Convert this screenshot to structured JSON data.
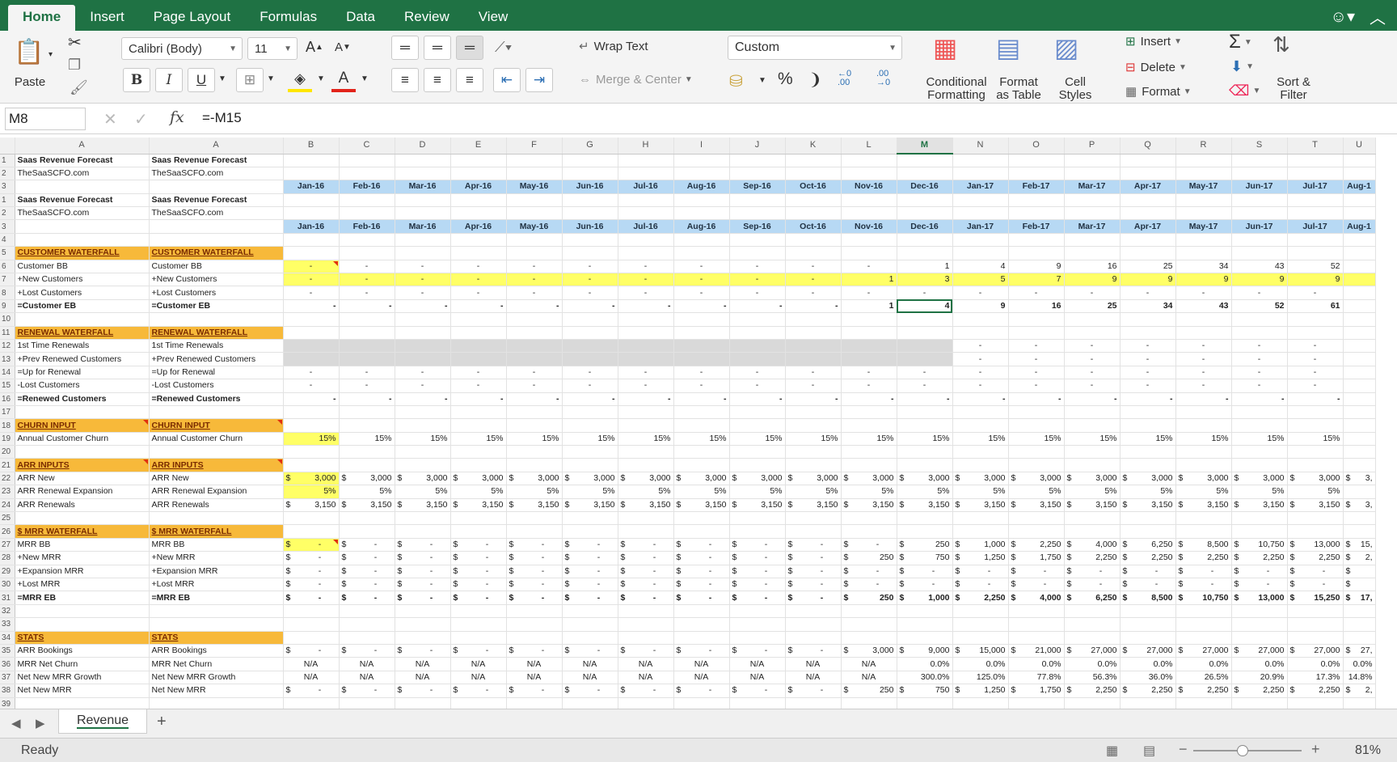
{
  "ribbon_tabs": [
    "Home",
    "Insert",
    "Page Layout",
    "Formulas",
    "Data",
    "Review",
    "View"
  ],
  "ribbon": {
    "paste": "Paste",
    "font_name": "Calibri (Body)",
    "font_size": "11",
    "bold": "B",
    "italic": "I",
    "underline": "U",
    "wrap_text": "Wrap Text",
    "merge_center": "Merge & Center",
    "number_format": "Custom",
    "percent": "%",
    "comma": "❩",
    "conditional_formatting": [
      "Conditional",
      "Formatting"
    ],
    "format_as_table": [
      "Format",
      "as Table"
    ],
    "cell_styles": [
      "Cell",
      "Styles"
    ],
    "insert": "Insert",
    "delete": "Delete",
    "format": "Format",
    "sort_filter": [
      "Sort &",
      "Filter"
    ]
  },
  "formula_bar": {
    "cell_ref": "M8",
    "formula": "=-M15",
    "fx": "fx"
  },
  "columns": [
    "A",
    "A",
    "B",
    "C",
    "D",
    "E",
    "F",
    "G",
    "H",
    "I",
    "J",
    "K",
    "L",
    "M",
    "N",
    "O",
    "P",
    "Q",
    "R",
    "S",
    "T",
    "U"
  ],
  "selected_col": "M",
  "selected_row": "8",
  "months": [
    "Jan-16",
    "Feb-16",
    "Mar-16",
    "Apr-16",
    "May-16",
    "Jun-16",
    "Jul-16",
    "Aug-16",
    "Sep-16",
    "Oct-16",
    "Nov-16",
    "Dec-16",
    "Jan-17",
    "Feb-17",
    "Mar-17",
    "Apr-17",
    "May-17",
    "Jun-17",
    "Jul-17",
    "Aug-1"
  ],
  "rows": [
    {
      "n": "1",
      "label": "Saas Revenue Forecast",
      "kind": "bold-label"
    },
    {
      "n": "2",
      "label": "TheSaaSCFO.com",
      "kind": "label"
    },
    {
      "n": "3",
      "label": "",
      "kind": "dates"
    },
    {
      "n": "1",
      "label": "Saas Revenue Forecast",
      "kind": "bold-label"
    },
    {
      "n": "2",
      "label": "TheSaaSCFO.com",
      "kind": "label"
    },
    {
      "n": "3",
      "label": "",
      "kind": "dates"
    },
    {
      "n": "4",
      "label": "",
      "kind": "blank"
    },
    {
      "n": "5",
      "label": "CUSTOMER WATERFALL",
      "kind": "section"
    },
    {
      "n": "6",
      "label": "Customer BB",
      "kind": "data",
      "first": "yellow-tri",
      "vals": [
        "-",
        "-",
        "-",
        "-",
        "-",
        "-",
        "-",
        "-",
        "-",
        "-",
        "-",
        "1",
        "4",
        "9",
        "16",
        "25",
        "34",
        "43",
        "52",
        ""
      ]
    },
    {
      "n": "7",
      "label": "+New Customers",
      "kind": "data",
      "row": "yellow",
      "vals": [
        "-",
        "-",
        "-",
        "-",
        "-",
        "-",
        "-",
        "-",
        "-",
        "-",
        "1",
        "3",
        "5",
        "7",
        "9",
        "9",
        "9",
        "9",
        "9",
        ""
      ]
    },
    {
      "n": "8",
      "label": "+Lost Customers",
      "kind": "data",
      "vals": [
        "-",
        "-",
        "-",
        "-",
        "-",
        "-",
        "-",
        "-",
        "-",
        "-",
        "-",
        "-",
        "-",
        "-",
        "-",
        "-",
        "-",
        "-",
        "-",
        ""
      ]
    },
    {
      "n": "9",
      "label": "=Customer EB",
      "kind": "total",
      "vals": [
        "-",
        "-",
        "-",
        "-",
        "-",
        "-",
        "-",
        "-",
        "-",
        "-",
        "1",
        "4",
        "9",
        "16",
        "25",
        "34",
        "43",
        "52",
        "61",
        ""
      ]
    },
    {
      "n": "10",
      "label": "",
      "kind": "blank"
    },
    {
      "n": "11",
      "label": "RENEWAL WATERFALL",
      "kind": "section"
    },
    {
      "n": "12",
      "label": "1st Time Renewals",
      "kind": "data",
      "grey": 12,
      "vals": [
        "",
        "",
        "",
        "",
        "",
        "",
        "",
        "",
        "",
        "",
        "",
        "",
        "-",
        "-",
        "-",
        "-",
        "-",
        "-",
        "-",
        ""
      ]
    },
    {
      "n": "13",
      "label": "+Prev Renewed Customers",
      "kind": "data",
      "grey": 12,
      "vals": [
        "",
        "",
        "",
        "",
        "",
        "",
        "",
        "",
        "",
        "",
        "",
        "",
        "-",
        "-",
        "-",
        "-",
        "-",
        "-",
        "-",
        ""
      ]
    },
    {
      "n": "14",
      "label": "=Up for Renewal",
      "kind": "data",
      "topline": true,
      "vals": [
        "-",
        "-",
        "-",
        "-",
        "-",
        "-",
        "-",
        "-",
        "-",
        "-",
        "-",
        "-",
        "-",
        "-",
        "-",
        "-",
        "-",
        "-",
        "-",
        ""
      ]
    },
    {
      "n": "15",
      "label": "-Lost Customers",
      "kind": "data",
      "vals": [
        "-",
        "-",
        "-",
        "-",
        "-",
        "-",
        "-",
        "-",
        "-",
        "-",
        "-",
        "-",
        "-",
        "-",
        "-",
        "-",
        "-",
        "-",
        "-",
        ""
      ]
    },
    {
      "n": "16",
      "label": "=Renewed Customers",
      "kind": "total",
      "vals": [
        "-",
        "-",
        "-",
        "-",
        "-",
        "-",
        "-",
        "-",
        "-",
        "-",
        "-",
        "-",
        "-",
        "-",
        "-",
        "-",
        "-",
        "-",
        "-",
        ""
      ]
    },
    {
      "n": "17",
      "label": "",
      "kind": "blank"
    },
    {
      "n": "18",
      "label": "CHURN INPUT",
      "kind": "section",
      "tri": true
    },
    {
      "n": "19",
      "label": "Annual Customer Churn",
      "kind": "data",
      "first": "yellow",
      "vals": [
        "15%",
        "15%",
        "15%",
        "15%",
        "15%",
        "15%",
        "15%",
        "15%",
        "15%",
        "15%",
        "15%",
        "15%",
        "15%",
        "15%",
        "15%",
        "15%",
        "15%",
        "15%",
        "15%",
        ""
      ]
    },
    {
      "n": "20",
      "label": "",
      "kind": "blank"
    },
    {
      "n": "21",
      "label": "ARR INPUTS",
      "kind": "section",
      "tri": true
    },
    {
      "n": "22",
      "label": "ARR New",
      "kind": "dollar",
      "first": "yellow",
      "vals": [
        "3,000",
        "3,000",
        "3,000",
        "3,000",
        "3,000",
        "3,000",
        "3,000",
        "3,000",
        "3,000",
        "3,000",
        "3,000",
        "3,000",
        "3,000",
        "3,000",
        "3,000",
        "3,000",
        "3,000",
        "3,000",
        "3,000",
        "3,"
      ]
    },
    {
      "n": "23",
      "label": "ARR Renewal Expansion",
      "kind": "data",
      "first": "yellow",
      "vals": [
        "5%",
        "5%",
        "5%",
        "5%",
        "5%",
        "5%",
        "5%",
        "5%",
        "5%",
        "5%",
        "5%",
        "5%",
        "5%",
        "5%",
        "5%",
        "5%",
        "5%",
        "5%",
        "5%",
        ""
      ]
    },
    {
      "n": "24",
      "label": "ARR Renewals",
      "kind": "dollar",
      "vals": [
        "3,150",
        "3,150",
        "3,150",
        "3,150",
        "3,150",
        "3,150",
        "3,150",
        "3,150",
        "3,150",
        "3,150",
        "3,150",
        "3,150",
        "3,150",
        "3,150",
        "3,150",
        "3,150",
        "3,150",
        "3,150",
        "3,150",
        "3,"
      ]
    },
    {
      "n": "25",
      "label": "",
      "kind": "blank"
    },
    {
      "n": "26",
      "label": "$ MRR WATERFALL",
      "kind": "section"
    },
    {
      "n": "27",
      "label": "MRR BB",
      "kind": "dollar",
      "first": "yellow-tri",
      "vals": [
        "-",
        "-",
        "-",
        "-",
        "-",
        "-",
        "-",
        "-",
        "-",
        "-",
        "-",
        "250",
        "1,000",
        "2,250",
        "4,000",
        "6,250",
        "8,500",
        "10,750",
        "13,000",
        "15,"
      ]
    },
    {
      "n": "28",
      "label": "+New MRR",
      "kind": "dollar",
      "vals": [
        "-",
        "-",
        "-",
        "-",
        "-",
        "-",
        "-",
        "-",
        "-",
        "-",
        "250",
        "750",
        "1,250",
        "1,750",
        "2,250",
        "2,250",
        "2,250",
        "2,250",
        "2,250",
        "2,"
      ]
    },
    {
      "n": "29",
      "label": "+Expansion MRR",
      "kind": "dollar",
      "vals": [
        "-",
        "-",
        "-",
        "-",
        "-",
        "-",
        "-",
        "-",
        "-",
        "-",
        "-",
        "-",
        "-",
        "-",
        "-",
        "-",
        "-",
        "-",
        "-",
        ""
      ]
    },
    {
      "n": "30",
      "label": "+Lost MRR",
      "kind": "dollar",
      "vals": [
        "-",
        "-",
        "-",
        "-",
        "-",
        "-",
        "-",
        "-",
        "-",
        "-",
        "-",
        "-",
        "-",
        "-",
        "-",
        "-",
        "-",
        "-",
        "-",
        ""
      ]
    },
    {
      "n": "31",
      "label": "=MRR EB",
      "kind": "dollar-total",
      "vals": [
        "-",
        "-",
        "-",
        "-",
        "-",
        "-",
        "-",
        "-",
        "-",
        "-",
        "250",
        "1,000",
        "2,250",
        "4,000",
        "6,250",
        "8,500",
        "10,750",
        "13,000",
        "15,250",
        "17,"
      ]
    },
    {
      "n": "32",
      "label": "",
      "kind": "blank"
    },
    {
      "n": "33",
      "label": "",
      "kind": "blank"
    },
    {
      "n": "34",
      "label": "STATS",
      "kind": "section"
    },
    {
      "n": "35",
      "label": "ARR Bookings",
      "kind": "dollar",
      "vals": [
        "-",
        "-",
        "-",
        "-",
        "-",
        "-",
        "-",
        "-",
        "-",
        "-",
        "3,000",
        "9,000",
        "15,000",
        "21,000",
        "27,000",
        "27,000",
        "27,000",
        "27,000",
        "27,000",
        "27,"
      ]
    },
    {
      "n": "36",
      "label": "MRR Net Churn",
      "kind": "center",
      "vals": [
        "N/A",
        "N/A",
        "N/A",
        "N/A",
        "N/A",
        "N/A",
        "N/A",
        "N/A",
        "N/A",
        "N/A",
        "N/A",
        "0.0%",
        "0.0%",
        "0.0%",
        "0.0%",
        "0.0%",
        "0.0%",
        "0.0%",
        "0.0%",
        "0.0%"
      ]
    },
    {
      "n": "37",
      "label": "Net New MRR Growth",
      "kind": "center",
      "vals": [
        "N/A",
        "N/A",
        "N/A",
        "N/A",
        "N/A",
        "N/A",
        "N/A",
        "N/A",
        "N/A",
        "N/A",
        "N/A",
        "300.0%",
        "125.0%",
        "77.8%",
        "56.3%",
        "36.0%",
        "26.5%",
        "20.9%",
        "17.3%",
        "14.8%"
      ]
    },
    {
      "n": "38",
      "label": "Net New MRR",
      "kind": "dollar",
      "vals": [
        "-",
        "-",
        "-",
        "-",
        "-",
        "-",
        "-",
        "-",
        "-",
        "-",
        "250",
        "750",
        "1,250",
        "1,750",
        "2,250",
        "2,250",
        "2,250",
        "2,250",
        "2,250",
        "2,"
      ]
    },
    {
      "n": "39",
      "label": "",
      "kind": "blank"
    }
  ],
  "sheet_tab": "Revenue",
  "add_sheet": "+",
  "status": "Ready",
  "zoom": "81%",
  "zoom_minus": "−",
  "zoom_plus": "+"
}
